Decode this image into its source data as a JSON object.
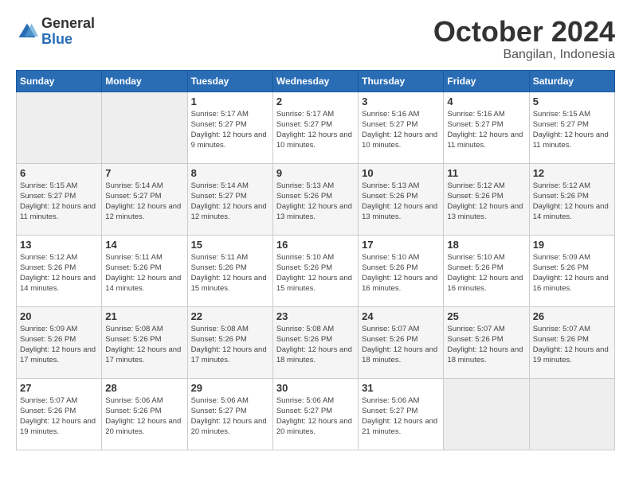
{
  "header": {
    "logo_general": "General",
    "logo_blue": "Blue",
    "month": "October 2024",
    "location": "Bangilan, Indonesia"
  },
  "weekdays": [
    "Sunday",
    "Monday",
    "Tuesday",
    "Wednesday",
    "Thursday",
    "Friday",
    "Saturday"
  ],
  "weeks": [
    [
      {
        "day": "",
        "info": ""
      },
      {
        "day": "",
        "info": ""
      },
      {
        "day": "1",
        "info": "Sunrise: 5:17 AM\nSunset: 5:27 PM\nDaylight: 12 hours and 9 minutes."
      },
      {
        "day": "2",
        "info": "Sunrise: 5:17 AM\nSunset: 5:27 PM\nDaylight: 12 hours and 10 minutes."
      },
      {
        "day": "3",
        "info": "Sunrise: 5:16 AM\nSunset: 5:27 PM\nDaylight: 12 hours and 10 minutes."
      },
      {
        "day": "4",
        "info": "Sunrise: 5:16 AM\nSunset: 5:27 PM\nDaylight: 12 hours and 11 minutes."
      },
      {
        "day": "5",
        "info": "Sunrise: 5:15 AM\nSunset: 5:27 PM\nDaylight: 12 hours and 11 minutes."
      }
    ],
    [
      {
        "day": "6",
        "info": "Sunrise: 5:15 AM\nSunset: 5:27 PM\nDaylight: 12 hours and 11 minutes."
      },
      {
        "day": "7",
        "info": "Sunrise: 5:14 AM\nSunset: 5:27 PM\nDaylight: 12 hours and 12 minutes."
      },
      {
        "day": "8",
        "info": "Sunrise: 5:14 AM\nSunset: 5:27 PM\nDaylight: 12 hours and 12 minutes."
      },
      {
        "day": "9",
        "info": "Sunrise: 5:13 AM\nSunset: 5:26 PM\nDaylight: 12 hours and 13 minutes."
      },
      {
        "day": "10",
        "info": "Sunrise: 5:13 AM\nSunset: 5:26 PM\nDaylight: 12 hours and 13 minutes."
      },
      {
        "day": "11",
        "info": "Sunrise: 5:12 AM\nSunset: 5:26 PM\nDaylight: 12 hours and 13 minutes."
      },
      {
        "day": "12",
        "info": "Sunrise: 5:12 AM\nSunset: 5:26 PM\nDaylight: 12 hours and 14 minutes."
      }
    ],
    [
      {
        "day": "13",
        "info": "Sunrise: 5:12 AM\nSunset: 5:26 PM\nDaylight: 12 hours and 14 minutes."
      },
      {
        "day": "14",
        "info": "Sunrise: 5:11 AM\nSunset: 5:26 PM\nDaylight: 12 hours and 14 minutes."
      },
      {
        "day": "15",
        "info": "Sunrise: 5:11 AM\nSunset: 5:26 PM\nDaylight: 12 hours and 15 minutes."
      },
      {
        "day": "16",
        "info": "Sunrise: 5:10 AM\nSunset: 5:26 PM\nDaylight: 12 hours and 15 minutes."
      },
      {
        "day": "17",
        "info": "Sunrise: 5:10 AM\nSunset: 5:26 PM\nDaylight: 12 hours and 16 minutes."
      },
      {
        "day": "18",
        "info": "Sunrise: 5:10 AM\nSunset: 5:26 PM\nDaylight: 12 hours and 16 minutes."
      },
      {
        "day": "19",
        "info": "Sunrise: 5:09 AM\nSunset: 5:26 PM\nDaylight: 12 hours and 16 minutes."
      }
    ],
    [
      {
        "day": "20",
        "info": "Sunrise: 5:09 AM\nSunset: 5:26 PM\nDaylight: 12 hours and 17 minutes."
      },
      {
        "day": "21",
        "info": "Sunrise: 5:08 AM\nSunset: 5:26 PM\nDaylight: 12 hours and 17 minutes."
      },
      {
        "day": "22",
        "info": "Sunrise: 5:08 AM\nSunset: 5:26 PM\nDaylight: 12 hours and 17 minutes."
      },
      {
        "day": "23",
        "info": "Sunrise: 5:08 AM\nSunset: 5:26 PM\nDaylight: 12 hours and 18 minutes."
      },
      {
        "day": "24",
        "info": "Sunrise: 5:07 AM\nSunset: 5:26 PM\nDaylight: 12 hours and 18 minutes."
      },
      {
        "day": "25",
        "info": "Sunrise: 5:07 AM\nSunset: 5:26 PM\nDaylight: 12 hours and 18 minutes."
      },
      {
        "day": "26",
        "info": "Sunrise: 5:07 AM\nSunset: 5:26 PM\nDaylight: 12 hours and 19 minutes."
      }
    ],
    [
      {
        "day": "27",
        "info": "Sunrise: 5:07 AM\nSunset: 5:26 PM\nDaylight: 12 hours and 19 minutes."
      },
      {
        "day": "28",
        "info": "Sunrise: 5:06 AM\nSunset: 5:26 PM\nDaylight: 12 hours and 20 minutes."
      },
      {
        "day": "29",
        "info": "Sunrise: 5:06 AM\nSunset: 5:27 PM\nDaylight: 12 hours and 20 minutes."
      },
      {
        "day": "30",
        "info": "Sunrise: 5:06 AM\nSunset: 5:27 PM\nDaylight: 12 hours and 20 minutes."
      },
      {
        "day": "31",
        "info": "Sunrise: 5:06 AM\nSunset: 5:27 PM\nDaylight: 12 hours and 21 minutes."
      },
      {
        "day": "",
        "info": ""
      },
      {
        "day": "",
        "info": ""
      }
    ]
  ]
}
